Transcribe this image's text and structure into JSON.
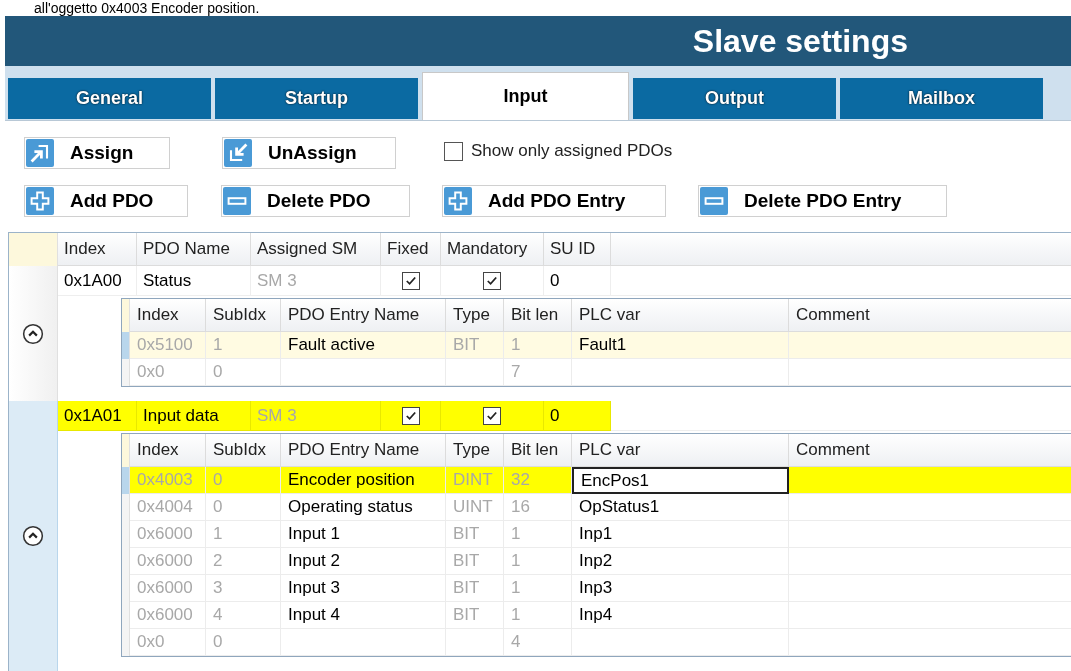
{
  "caption": "all'oggetto 0x4003 Encoder position.",
  "window": {
    "title": "Slave settings"
  },
  "tabs": [
    {
      "label": "General",
      "selected": false
    },
    {
      "label": "Startup",
      "selected": false
    },
    {
      "label": "Input",
      "selected": true
    },
    {
      "label": "Output",
      "selected": false
    },
    {
      "label": "Mailbox",
      "selected": false
    }
  ],
  "toolbar_rows": [
    [
      {
        "kind": "assign",
        "label": "Assign"
      },
      {
        "kind": "unassign",
        "label": "UnAssign"
      },
      {
        "kind": "checkbox",
        "label": "Show only assigned PDOs",
        "checked": false
      }
    ],
    [
      {
        "kind": "add",
        "label": "Add PDO"
      },
      {
        "kind": "remove",
        "label": "Delete PDO"
      },
      {
        "kind": "add",
        "label": "Add PDO Entry"
      },
      {
        "kind": "remove",
        "label": "Delete PDO Entry"
      }
    ]
  ],
  "pdo_table": {
    "columns": [
      "Index",
      "PDO Name",
      "Assigned SM",
      "Fixed",
      "Mandatory",
      "SU ID"
    ],
    "rows": [
      {
        "index": "0x1A00",
        "name": "Status",
        "sm": "SM 3",
        "fixed": true,
        "mandatory": true,
        "su_id": "0",
        "selected": false,
        "expanded": true,
        "entry_columns": [
          "Index",
          "SubIdx",
          "PDO Entry Name",
          "Type",
          "Bit len",
          "PLC var",
          "Comment"
        ],
        "entries": [
          {
            "index": "0x5100",
            "subidx": "1",
            "name": "Fault active",
            "type": "BIT",
            "bit_len": "1",
            "plc_var": "Fault1",
            "selected": true,
            "editing": false
          },
          {
            "index": "0x0",
            "subidx": "0",
            "bit_len": "7",
            "selected": false,
            "editing": false
          }
        ]
      },
      {
        "index": "0x1A01",
        "name": "Input data",
        "sm": "SM 3",
        "fixed": true,
        "mandatory": true,
        "su_id": "0",
        "selected": true,
        "expanded": true,
        "entry_columns": [
          "Index",
          "SubIdx",
          "PDO Entry Name",
          "Type",
          "Bit len",
          "PLC var",
          "Comment"
        ],
        "entries": [
          {
            "index": "0x4003",
            "subidx": "0",
            "name": "Encoder position",
            "type": "DINT",
            "bit_len": "32",
            "plc_var": "EncPos1",
            "selected": true,
            "editing": true
          },
          {
            "index": "0x4004",
            "subidx": "0",
            "name": "Operating status",
            "type": "UINT",
            "bit_len": "16",
            "plc_var": "OpStatus1",
            "selected": false,
            "editing": false
          },
          {
            "index": "0x6000",
            "subidx": "1",
            "name": "Input 1",
            "type": "BIT",
            "bit_len": "1",
            "plc_var": "Inp1",
            "selected": false,
            "editing": false
          },
          {
            "index": "0x6000",
            "subidx": "2",
            "name": "Input 2",
            "type": "BIT",
            "bit_len": "1",
            "plc_var": "Inp2",
            "selected": false,
            "editing": false
          },
          {
            "index": "0x6000",
            "subidx": "3",
            "name": "Input 3",
            "type": "BIT",
            "bit_len": "1",
            "plc_var": "Inp3",
            "selected": false,
            "editing": false
          },
          {
            "index": "0x6000",
            "subidx": "4",
            "name": "Input 4",
            "type": "BIT",
            "bit_len": "1",
            "plc_var": "Inp4",
            "selected": false,
            "editing": false
          },
          {
            "index": "0x0",
            "subidx": "0",
            "bit_len": "4",
            "selected": false,
            "editing": false
          }
        ]
      }
    ]
  }
}
